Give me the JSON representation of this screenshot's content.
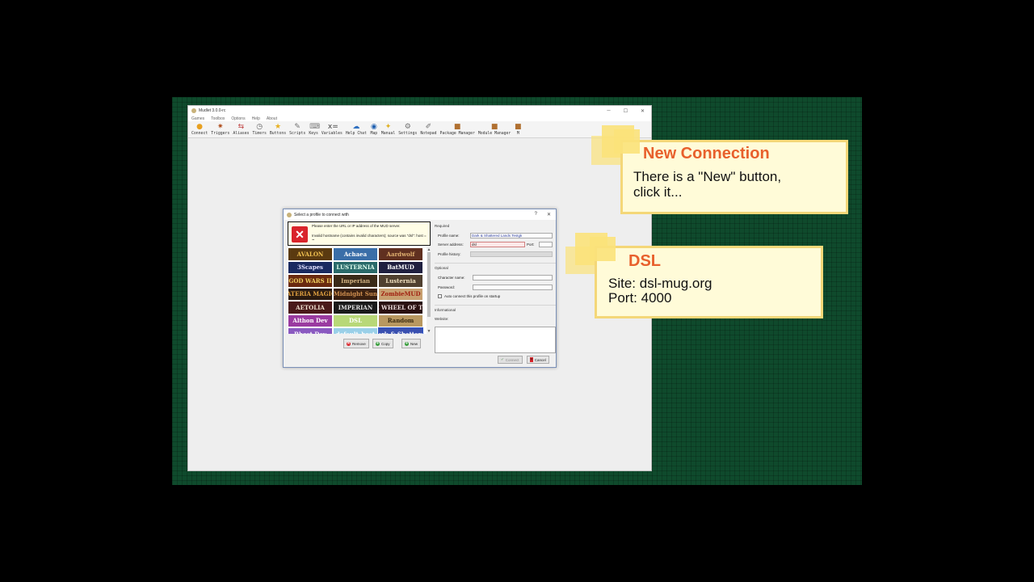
{
  "window": {
    "title": "Mudlet 3.0.0-rc",
    "controls": [
      "─",
      "☐",
      "✕"
    ]
  },
  "menu": [
    "Games",
    "Toolbox",
    "Options",
    "Help",
    "About"
  ],
  "toolbar": [
    {
      "label": "Connect",
      "icon": "connect-icon",
      "glyph": "●",
      "color": "#e8a020"
    },
    {
      "label": "Triggers",
      "icon": "triggers-icon",
      "glyph": "✷",
      "color": "#b05020"
    },
    {
      "label": "Aliases",
      "icon": "aliases-icon",
      "glyph": "⇆",
      "color": "#c04040"
    },
    {
      "label": "Timers",
      "icon": "timers-icon",
      "glyph": "◷",
      "color": "#606060"
    },
    {
      "label": "Buttons",
      "icon": "buttons-icon",
      "glyph": "★",
      "color": "#e8b020"
    },
    {
      "label": "Scripts",
      "icon": "scripts-icon",
      "glyph": "✎",
      "color": "#707070"
    },
    {
      "label": "Keys",
      "icon": "keys-icon",
      "glyph": "⌨",
      "color": "#808080"
    },
    {
      "label": "Variables",
      "icon": "variables-icon",
      "glyph": "x=",
      "color": "#404040"
    },
    {
      "label": "Help Chat",
      "icon": "help-chat-icon",
      "glyph": "☁",
      "color": "#3070c0"
    },
    {
      "label": "Map",
      "icon": "map-icon",
      "glyph": "◉",
      "color": "#2060b0"
    },
    {
      "label": "Manual",
      "icon": "manual-icon",
      "glyph": "✦",
      "color": "#e0b020"
    },
    {
      "label": "Settings",
      "icon": "settings-icon",
      "glyph": "⚙",
      "color": "#707070"
    },
    {
      "label": "Notepad",
      "icon": "notepad-icon",
      "glyph": "✐",
      "color": "#707070"
    },
    {
      "label": "Package Manager",
      "icon": "package-manager-icon",
      "glyph": "■",
      "color": "#b07030"
    },
    {
      "label": "Module Manager",
      "icon": "module-manager-icon",
      "glyph": "■",
      "color": "#b07030"
    },
    {
      "label": "M",
      "icon": "more-icon",
      "glyph": "■",
      "color": "#b07030"
    }
  ],
  "dialog": {
    "title": "Select a profile to connect with",
    "help": "?",
    "close": "✕",
    "error": {
      "line1": "Please enter the URL or IP address of the MUD server.",
      "line2": "Invalid hostname (contains invalid characters); source was \"dsl\": host = \"\""
    },
    "profiles": [
      {
        "name": "AVALON",
        "bg": "#5a3a10",
        "fg": "#f0c050"
      },
      {
        "name": "Achaea",
        "bg": "#3a6ea8",
        "fg": "#ffffff"
      },
      {
        "name": "Aardwolf",
        "bg": "#603020",
        "fg": "#e0b070"
      },
      {
        "name": "3Scapes",
        "bg": "#1a2a60",
        "fg": "#e0e0ff"
      },
      {
        "name": "LUSTERNIA",
        "bg": "#2a6a6a",
        "fg": "#e0fff0"
      },
      {
        "name": "BatMUD",
        "bg": "#202040",
        "fg": "#ffffff"
      },
      {
        "name": "GOD WARS II",
        "bg": "#6a2a10",
        "fg": "#f0d060"
      },
      {
        "name": "Imperian",
        "bg": "#3a2a18",
        "fg": "#d0b080"
      },
      {
        "name": "Lusternia",
        "bg": "#504030",
        "fg": "#f0e0c0"
      },
      {
        "name": "MATERIA MAGICA",
        "bg": "#2a1a10",
        "fg": "#e0a040"
      },
      {
        "name": "Midnight Sun",
        "bg": "#3a2010",
        "fg": "#d09050"
      },
      {
        "name": "ZombieMUD",
        "bg": "#c8a070",
        "fg": "#a02010"
      },
      {
        "name": "AETOLIA",
        "bg": "#4a1a1a",
        "fg": "#f0e0d0"
      },
      {
        "name": "IMPERIAN",
        "bg": "#1a1a1a",
        "fg": "#e0e0e0"
      },
      {
        "name": "THE WHEEL OF TIME",
        "bg": "#2a1010",
        "fg": "#f0e0e0"
      },
      {
        "name": "Althon Dev",
        "bg": "#9a3aa0",
        "fg": "#ffffff"
      },
      {
        "name": "DSL",
        "bg": "#b8d878",
        "fg": "#ffffff"
      },
      {
        "name": "Random",
        "bg": "#b89860",
        "fg": "#3a2a10"
      },
      {
        "name": "Bhost Dev",
        "bg": "#8a5ac0",
        "fg": "#ffffff"
      },
      {
        "name": "default_host",
        "bg": "#9ad0e8",
        "fg": "#ffffff"
      },
      {
        "name": "Dark & Shattered",
        "bg": "#3a50b0",
        "fg": "#ffffff"
      }
    ],
    "buttons": {
      "remove": "Remove",
      "copy": "Copy",
      "new": "New",
      "connect": "Connect",
      "cancel": "Cancel"
    },
    "form": {
      "required": "Required",
      "profile_name_label": "Profile name:",
      "profile_name": "Dark & Shattered Lands Testgk",
      "server_label": "Server address:",
      "server": "dsl",
      "port_label": "Port:",
      "port": "",
      "history_label": "Profile history:",
      "optional": "Optional",
      "character_label": "Character name:",
      "password_label": "Password:",
      "autoconnect": "Auto connect this profile on startup",
      "informational": "Informational",
      "website_label": "Website:"
    }
  },
  "callouts": {
    "new_connection": {
      "title": "New Connection",
      "line1": "There is a \"New\" button,",
      "line2": "click it..."
    },
    "dsl": {
      "title": "DSL",
      "line1": "Site: dsl-mug.org",
      "line2": "Port: 4000"
    }
  }
}
